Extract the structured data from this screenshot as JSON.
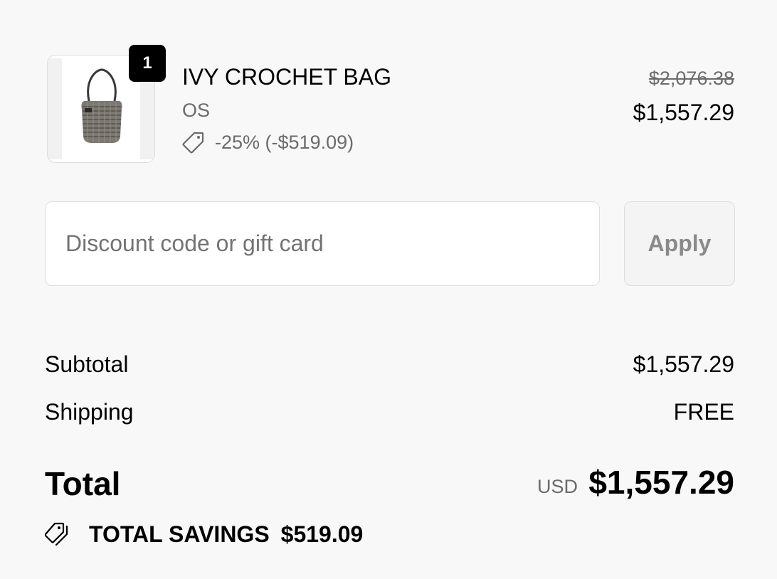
{
  "cart": {
    "item": {
      "quantity": "1",
      "title": "IVY CROCHET BAG",
      "variant": "OS",
      "discount_text": "-25% (-$519.09)",
      "price_original": "$2,076.38",
      "price_final": "$1,557.29",
      "image_icon": "bag-product-image"
    }
  },
  "discount": {
    "placeholder": "Discount code or gift card",
    "value": "",
    "apply_label": "Apply"
  },
  "summary": {
    "subtotal_label": "Subtotal",
    "subtotal_value": "$1,557.29",
    "shipping_label": "Shipping",
    "shipping_value": "FREE",
    "total_label": "Total",
    "total_currency": "USD",
    "total_value": "$1,557.29",
    "savings_label": "TOTAL SAVINGS",
    "savings_value": "$519.09"
  },
  "icons": {
    "discount_tag": "tag-icon",
    "savings_tags": "tags-icon"
  }
}
